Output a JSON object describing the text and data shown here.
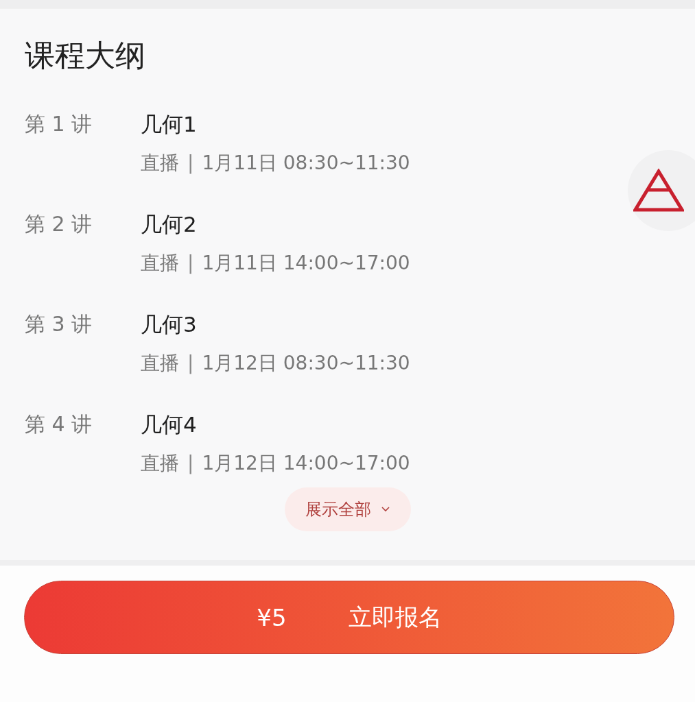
{
  "section": {
    "title": "课程大纲"
  },
  "lessons": [
    {
      "number": "第 1 讲",
      "title": "几何1",
      "mode": "直播",
      "time": "1月11日 08:30~11:30"
    },
    {
      "number": "第 2 讲",
      "title": "几何2",
      "mode": "直播",
      "time": "1月11日 14:00~17:00"
    },
    {
      "number": "第 3 讲",
      "title": "几何3",
      "mode": "直播",
      "time": "1月12日 08:30~11:30"
    },
    {
      "number": "第 4 讲",
      "title": "几何4",
      "mode": "直播",
      "time": "1月12日 14:00~17:00"
    }
  ],
  "separator": "|",
  "expand_button": {
    "label": "展示全部"
  },
  "enroll_button": {
    "price": "¥5",
    "label": "立即报名"
  }
}
